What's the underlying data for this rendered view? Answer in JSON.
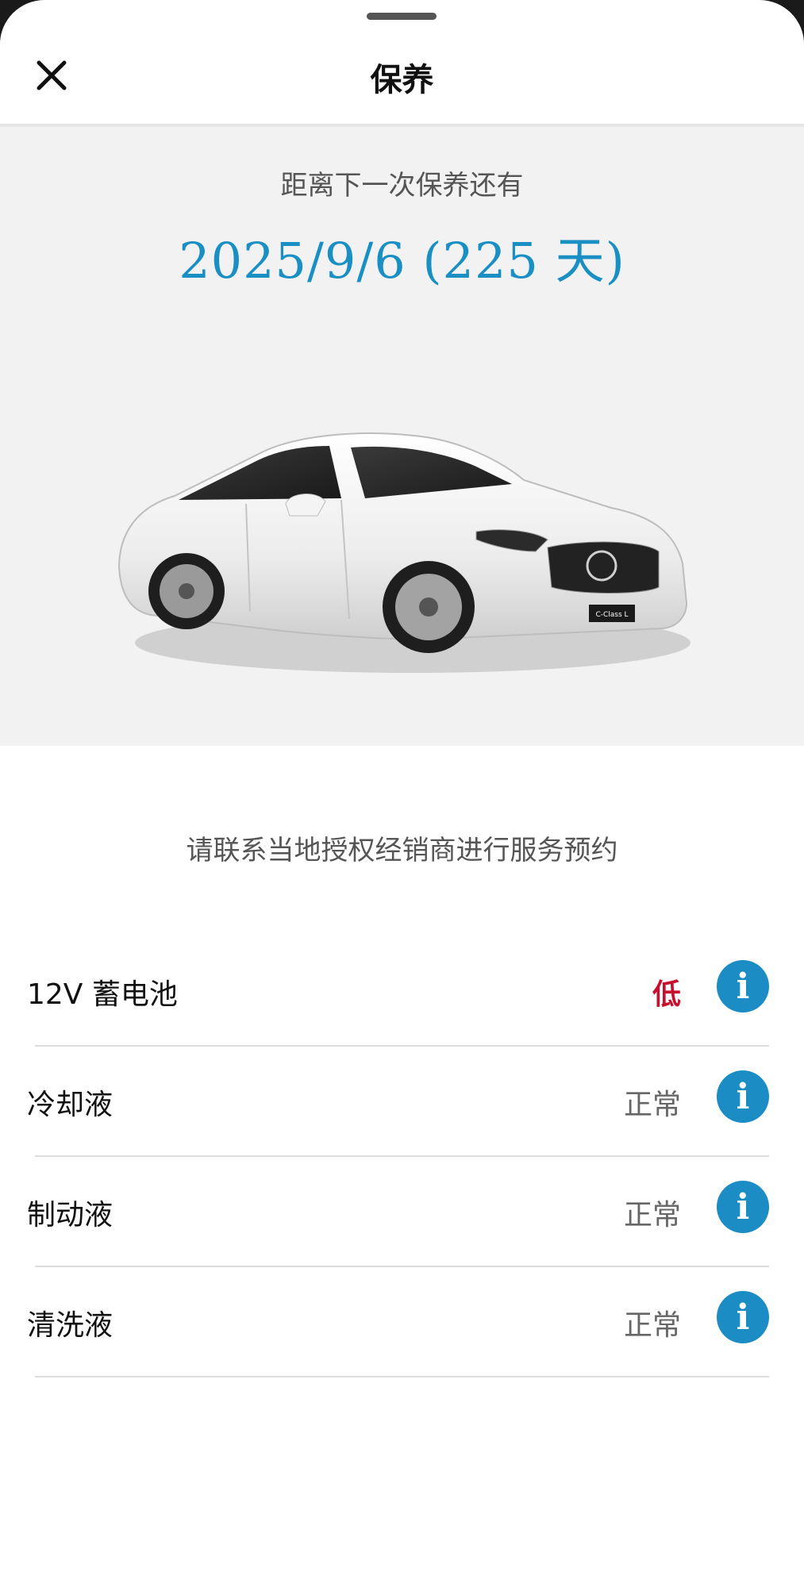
{
  "header": {
    "title": "保养",
    "close_icon": "close-icon"
  },
  "hero": {
    "caption": "距离下一次保养还有",
    "next_service": "2025/9/6 (225 天)",
    "accent_color": "#1a8fc4",
    "vehicle_plate_text": "C-Class L"
  },
  "service_note": "请联系当地授权经销商进行服务预约",
  "status_items": [
    {
      "label": "12V 蓄电池",
      "value": "低",
      "state": "low",
      "icon": "info-icon"
    },
    {
      "label": "冷却液",
      "value": "正常",
      "state": "normal",
      "icon": "info-icon"
    },
    {
      "label": "制动液",
      "value": "正常",
      "state": "normal",
      "icon": "info-icon"
    },
    {
      "label": "清洗液",
      "value": "正常",
      "state": "normal",
      "icon": "info-icon"
    }
  ],
  "colors": {
    "low_status": "#c8102e",
    "info_button": "#1b8cc4"
  }
}
